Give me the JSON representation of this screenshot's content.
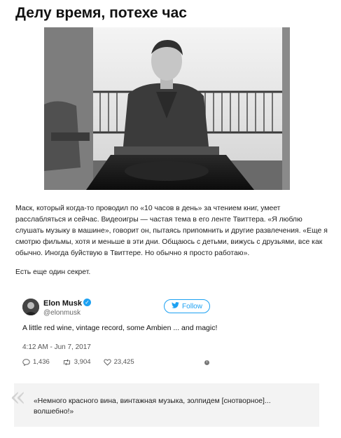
{
  "title": "Делу время, потехе час",
  "photo": {
    "alt_icon": "photo-elon-musk-icon"
  },
  "article": {
    "paragraph": "Маск, который когда-то проводил по «10 часов в день» за чтением книг, умеет расслабляться и сейчас. Видеоигры — частая тема в его ленте Твиттера. «Я люблю слушать музыку в машине», говорит он, пытаясь припомнить и другие развлечения. «Еще я смотрю фильмы, хотя и меньше в эти дни. Общаюсь с детьми, вижусь с друзьями, все как обычно. Иногда буйствую в Твиттере. Но обычно я просто работаю».",
    "after": "Есть еще один секрет."
  },
  "tweet": {
    "name": "Elon Musk",
    "handle": "@elonmusk",
    "follow_label": "Follow",
    "text": "A little red wine, vintage record, some Ambien ... and magic!",
    "date": "4:12 AM - Jun 7, 2017",
    "replies": "1,436",
    "retweets": "3,904",
    "likes": "23,425",
    "accent": "#1da1f2"
  },
  "quote": {
    "mark": "«",
    "text": "«Немного красного вина, винтажная музыка, золпидем [снотворное]... волшебно!»"
  }
}
